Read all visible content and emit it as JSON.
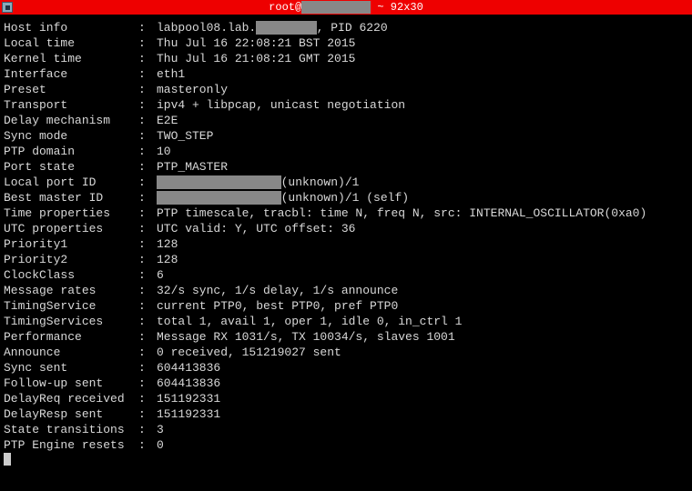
{
  "titlebar": {
    "prefix": "root@",
    "redacted": "          ",
    "suffix": " ~ 92x30"
  },
  "rows": [
    {
      "label": "Host info",
      "value_parts": [
        {
          "t": "labpool08.lab."
        },
        {
          "t": "        ",
          "redacted": true
        },
        {
          "t": ", PID 6220"
        }
      ]
    },
    {
      "label": "Local time",
      "value": "Thu Jul 16 22:08:21 BST 2015"
    },
    {
      "label": "Kernel time",
      "value": "Thu Jul 16 21:08:21 GMT 2015"
    },
    {
      "label": "Interface",
      "value": "eth1"
    },
    {
      "label": "Preset",
      "value": "masteronly"
    },
    {
      "label": "Transport",
      "value": "ipv4 + libpcap, unicast negotiation"
    },
    {
      "label": "Delay mechanism",
      "value": "E2E"
    },
    {
      "label": "Sync mode",
      "value": "TWO_STEP"
    },
    {
      "label": "PTP domain",
      "value": "10"
    },
    {
      "label": "Port state",
      "value": "PTP_MASTER"
    },
    {
      "label": "Local port ID",
      "value_parts": [
        {
          "t": "                 ",
          "redacted": true
        },
        {
          "t": "(unknown)/1"
        }
      ]
    },
    {
      "label": "Best master ID",
      "value_parts": [
        {
          "t": "                 ",
          "redacted": true
        },
        {
          "t": "(unknown)/1 (self)"
        }
      ]
    },
    {
      "label": "Time properties",
      "value": "PTP timescale, tracbl: time N, freq N, src: INTERNAL_OSCILLATOR(0xa0)"
    },
    {
      "label": "UTC properties",
      "value": "UTC valid: Y, UTC offset: 36"
    },
    {
      "label": "Priority1",
      "value": "128"
    },
    {
      "label": "Priority2",
      "value": "128"
    },
    {
      "label": "ClockClass",
      "value": "6"
    },
    {
      "label": "Message rates",
      "value": "32/s sync, 1/s delay, 1/s announce"
    },
    {
      "label": "TimingService",
      "value": "current PTP0, best PTP0, pref PTP0"
    },
    {
      "label": "TimingServices",
      "value": "total 1, avail 1, oper 1, idle 0, in_ctrl 1"
    },
    {
      "label": "Performance",
      "value": "Message RX 1031/s, TX 10034/s, slaves 1001"
    },
    {
      "label": "Announce",
      "value": "0 received, 151219027 sent"
    },
    {
      "label": "Sync sent",
      "value": "604413836"
    },
    {
      "label": "Follow-up sent",
      "value": "604413836"
    },
    {
      "label": "DelayReq received",
      "value": "151192331"
    },
    {
      "label": "DelayResp sent",
      "value": "151192331"
    },
    {
      "label": "State transitions",
      "value": "3"
    },
    {
      "label": "PTP Engine resets",
      "value": "0"
    }
  ],
  "separator": ":  "
}
